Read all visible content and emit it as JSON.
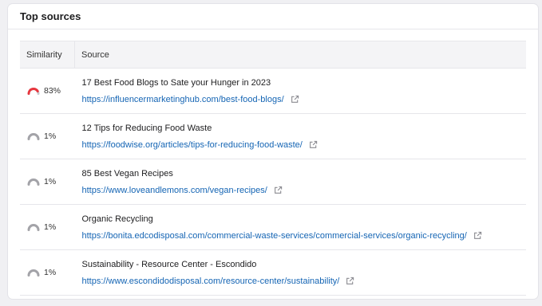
{
  "card": {
    "title": "Top sources"
  },
  "table": {
    "headers": {
      "similarity": "Similarity",
      "source": "Source"
    },
    "rows": [
      {
        "similarity": "83%",
        "similarity_value": 0.83,
        "gauge_color": "#e8363e",
        "title": "17 Best Food Blogs to Sate your Hunger in 2023",
        "url": "https://influencermarketinghub.com/best-food-blogs/"
      },
      {
        "similarity": "1%",
        "similarity_value": 0.01,
        "gauge_color": "#a3a3a8",
        "title": "12 Tips for Reducing Food Waste",
        "url": "https://foodwise.org/articles/tips-for-reducing-food-waste/"
      },
      {
        "similarity": "1%",
        "similarity_value": 0.01,
        "gauge_color": "#a3a3a8",
        "title": "85 Best Vegan Recipes",
        "url": "https://www.loveandlemons.com/vegan-recipes/"
      },
      {
        "similarity": "1%",
        "similarity_value": 0.01,
        "gauge_color": "#a3a3a8",
        "title": "Organic Recycling",
        "url": "https://bonita.edcodisposal.com/commercial-waste-services/commercial-services/organic-recycling/"
      },
      {
        "similarity": "1%",
        "similarity_value": 0.01,
        "gauge_color": "#a3a3a8",
        "title": "Sustainability - Resource Center - Escondido",
        "url": "https://www.escondidodisposal.com/resource-center/sustainability/"
      }
    ]
  },
  "colors": {
    "link": "#1565b4",
    "gauge_track": "#c6c6cb",
    "gauge_high": "#e8363e",
    "gauge_low": "#a3a3a8"
  },
  "icons": {
    "external_link": "external-link-icon",
    "gauge": "similarity-gauge-icon"
  }
}
